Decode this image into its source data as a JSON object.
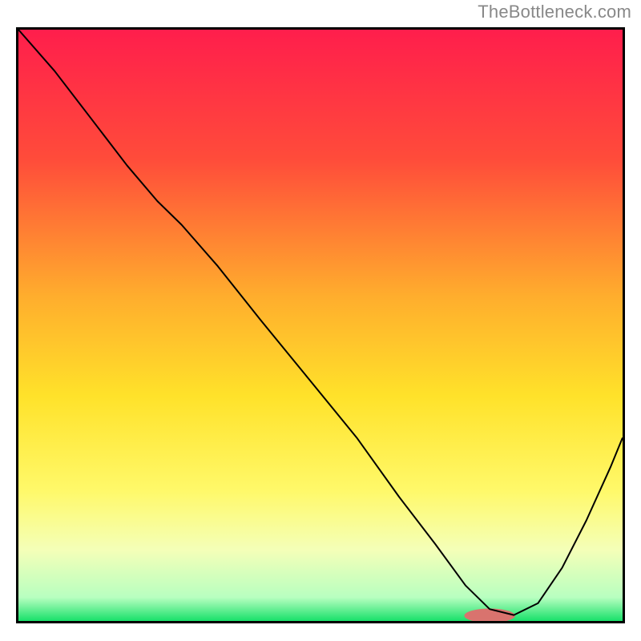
{
  "watermark": "TheBottleneck.com",
  "chart_data": {
    "type": "line",
    "title": "",
    "xlabel": "",
    "ylabel": "",
    "xlim": [
      0,
      100
    ],
    "ylim": [
      0,
      100
    ],
    "background": {
      "type": "vertical-gradient",
      "stops": [
        {
          "pos": 0.0,
          "color": "#ff1e4c"
        },
        {
          "pos": 0.22,
          "color": "#ff4c3a"
        },
        {
          "pos": 0.45,
          "color": "#ffad2d"
        },
        {
          "pos": 0.62,
          "color": "#ffe22a"
        },
        {
          "pos": 0.78,
          "color": "#fff96a"
        },
        {
          "pos": 0.88,
          "color": "#f4ffb8"
        },
        {
          "pos": 0.96,
          "color": "#b8ffc0"
        },
        {
          "pos": 1.0,
          "color": "#18e06a"
        }
      ]
    },
    "series": [
      {
        "name": "bottleneck-curve",
        "color": "#000000",
        "width": 2,
        "x": [
          0,
          6,
          12,
          18,
          23,
          27,
          33,
          40,
          48,
          56,
          63,
          69,
          74,
          78,
          82,
          86,
          90,
          94,
          98,
          100
        ],
        "y": [
          100,
          93,
          85,
          77,
          71,
          67,
          60,
          51,
          41,
          31,
          21,
          13,
          6,
          2,
          1,
          3,
          9,
          17,
          26,
          31
        ]
      }
    ],
    "marker": {
      "name": "optimal-range-marker",
      "color": "#d9736e",
      "x_center": 78,
      "y_center": 0.9,
      "rx_percent_of_x": 4.2,
      "ry_percent_of_y": 1.2
    }
  }
}
